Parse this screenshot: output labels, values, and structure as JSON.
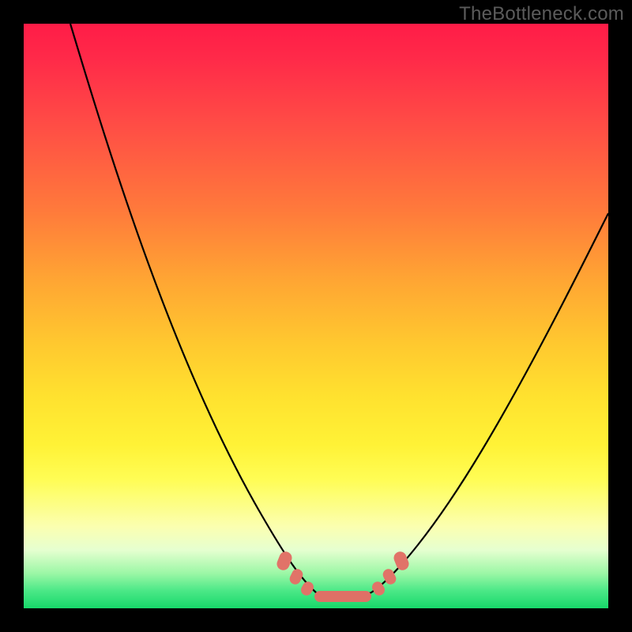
{
  "watermark": "TheBottleneck.com",
  "chart_data": {
    "type": "line",
    "title": "",
    "xlabel": "",
    "ylabel": "",
    "xlim": [
      0,
      100
    ],
    "ylim": [
      0,
      100
    ],
    "series": [
      {
        "name": "left-branch",
        "x": [
          8,
          12,
          16,
          20,
          24,
          28,
          32,
          36,
          40,
          44,
          46,
          48
        ],
        "y": [
          100,
          82,
          66,
          52,
          40,
          30,
          22,
          15,
          9,
          5,
          3,
          2
        ]
      },
      {
        "name": "valley",
        "x": [
          48,
          52,
          56,
          60
        ],
        "y": [
          2,
          1.5,
          1.5,
          2
        ]
      },
      {
        "name": "right-branch",
        "x": [
          60,
          64,
          68,
          72,
          76,
          80,
          84,
          88,
          92,
          96,
          100
        ],
        "y": [
          2,
          4,
          8,
          14,
          21,
          29,
          38,
          48,
          58,
          64,
          68
        ]
      }
    ],
    "markers": [
      {
        "name": "left-marker-1",
        "x": 44.5,
        "y": 6
      },
      {
        "name": "left-marker-2",
        "x": 46.5,
        "y": 4
      },
      {
        "name": "left-marker-3",
        "x": 48.0,
        "y": 2.5
      },
      {
        "name": "valley-bar",
        "x": 54,
        "y": 1.6,
        "wide": true
      },
      {
        "name": "right-marker-1",
        "x": 60.0,
        "y": 2.6
      },
      {
        "name": "right-marker-2",
        "x": 62.0,
        "y": 4
      },
      {
        "name": "right-marker-3",
        "x": 64.0,
        "y": 6
      }
    ],
    "gradient_stops": [
      {
        "pos": 0,
        "color": "#ff1c47"
      },
      {
        "pos": 32,
        "color": "#ff7a3b"
      },
      {
        "pos": 64,
        "color": "#ffe22f"
      },
      {
        "pos": 90,
        "color": "#e6ffd0"
      },
      {
        "pos": 100,
        "color": "#17d86a"
      }
    ]
  }
}
